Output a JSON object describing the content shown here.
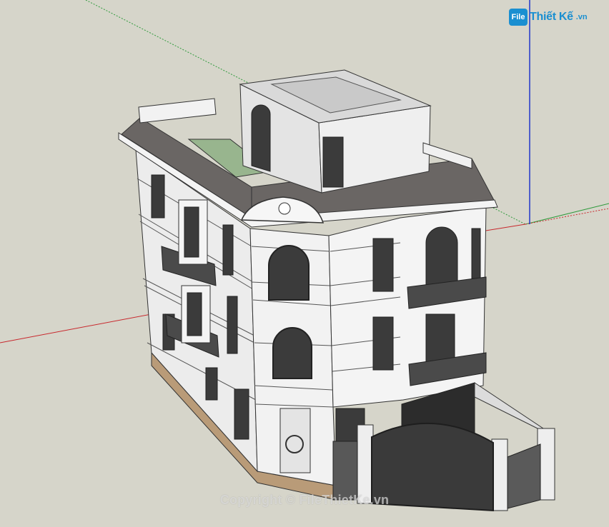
{
  "app": {
    "viewport_label": "SketchUp 3D model viewport",
    "background_color": "#d6d5ca"
  },
  "logo": {
    "mark": "File",
    "text": "Thiết Kế",
    "suffix": ".vn",
    "color": "#1a8fd1"
  },
  "watermark": {
    "text": "Copyright © FileThietKe.vn"
  },
  "axes": {
    "red_color": "#c8282d",
    "green_color": "#2f9a3c",
    "blue_color": "#2036c9"
  },
  "model": {
    "wall_color": "#f2f2f2",
    "roof_color": "#6a6664",
    "base_color": "#b99b78",
    "terrace_color": "#98b58e"
  }
}
